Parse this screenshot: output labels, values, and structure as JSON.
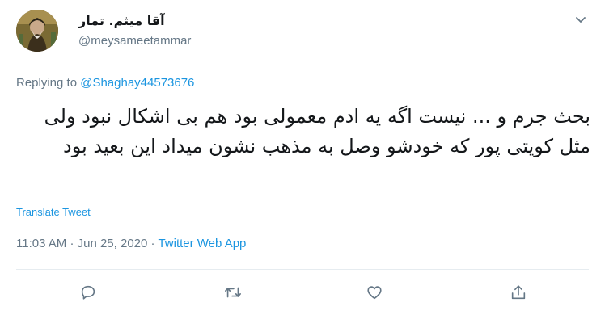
{
  "author": {
    "display_name": "آقا میثم. تمار",
    "handle": "@meysameetammar"
  },
  "reply": {
    "prefix": "Replying to",
    "mention": "@Shaghay44573676"
  },
  "tweet": {
    "text": "بحث جرم و ... نیست اگه یه ادم معمولی بود هم بی اشکال نبود ولی مثل کویتی پور که خودشو وصل به مذهب نشون میداد این بعید بود"
  },
  "translate_label": "Translate Tweet",
  "meta": {
    "time": "11:03 AM",
    "separator": "·",
    "date": "Jun 25, 2020",
    "app": "Twitter Web App"
  },
  "actions": [
    {
      "icon": "reply-icon"
    },
    {
      "icon": "retweet-icon"
    },
    {
      "icon": "like-icon"
    },
    {
      "icon": "share-icon"
    }
  ],
  "colors": {
    "link": "#1b95e0",
    "secondary": "#657786",
    "divider": "#e6ecf0"
  }
}
